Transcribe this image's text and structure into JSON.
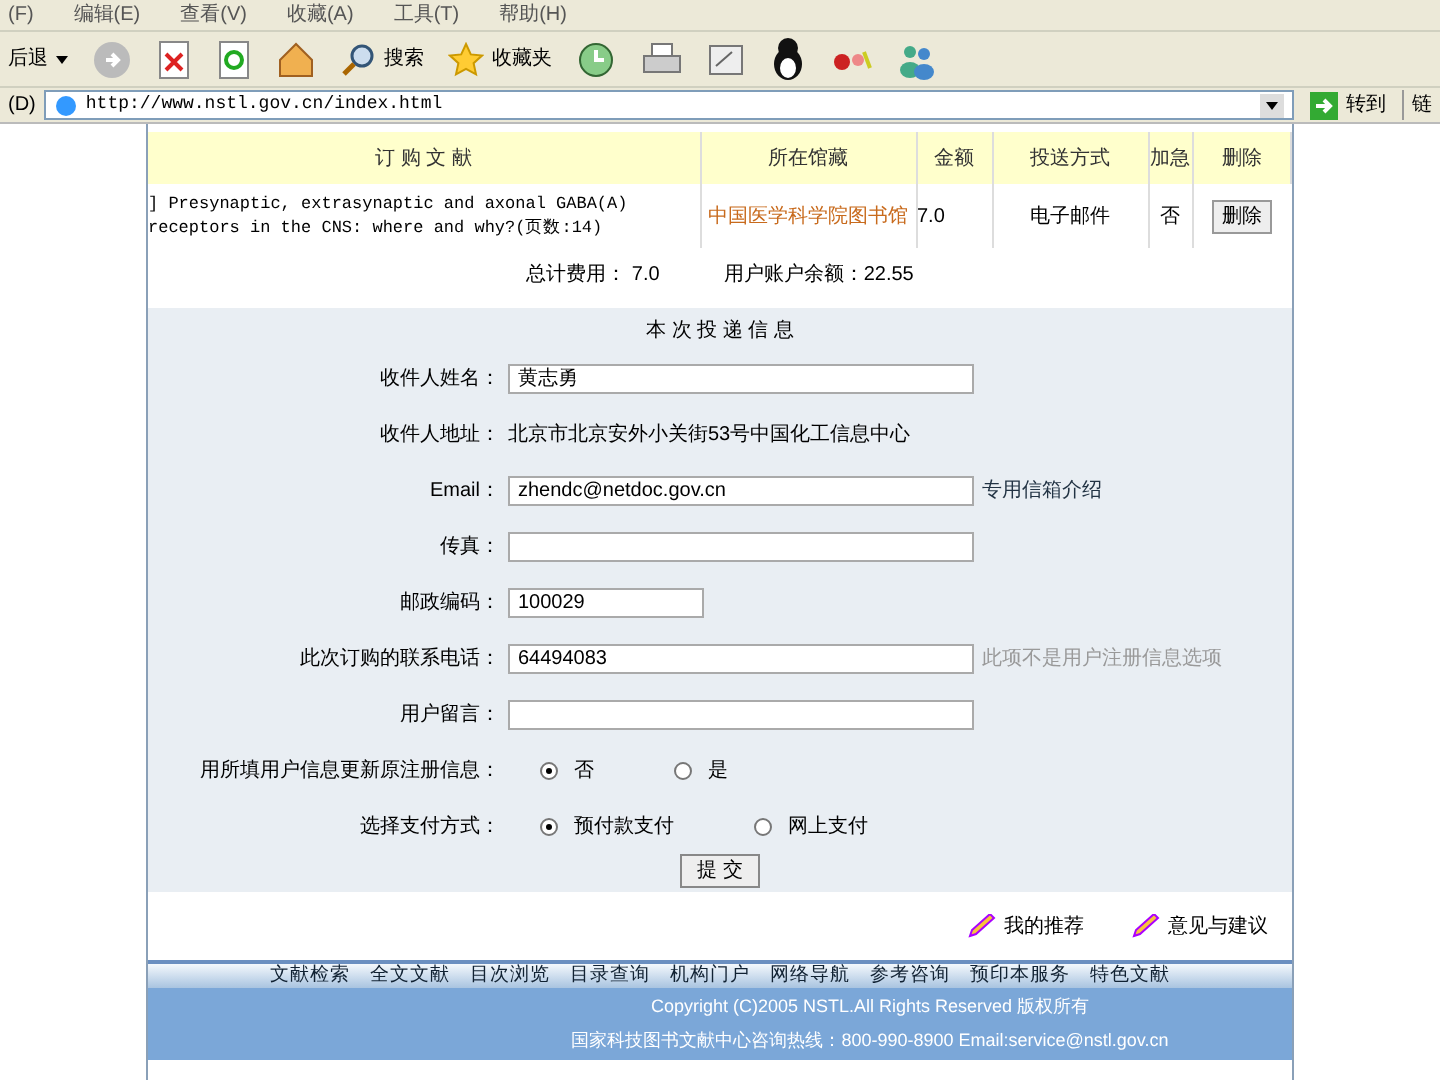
{
  "menu": [
    "(F)",
    "编辑(E)",
    "查看(V)",
    "收藏(A)",
    "工具(T)",
    "帮助(H)"
  ],
  "toolbar": {
    "back": "后退",
    "search": "搜索",
    "favorites": "收藏夹"
  },
  "address": {
    "label": "(D)",
    "url": "http://www.nstl.gov.cn/index.html",
    "go": "转到",
    "links": "链"
  },
  "order_table": {
    "columns": [
      "订 购 文 献",
      "所在馆藏",
      "金额",
      "投送方式",
      "加急",
      "删除"
    ],
    "rows": [
      {
        "title": "] Presynaptic, extrasynaptic and axonal GABA(A) receptors in the CNS: where and why?(页数:14)",
        "library": "中国医学科学院图书馆",
        "amount": "7.0",
        "delivery": "电子邮件",
        "urgent": "否",
        "action": "删除"
      }
    ]
  },
  "totals": {
    "cost": "总计费用： 7.0",
    "balance": "用户账户余额：22.55"
  },
  "delivery_form": {
    "title": "本 次 投 递 信 息",
    "rows": [
      {
        "kind": "input",
        "label": "收件人姓名：",
        "value": "黄志勇"
      },
      {
        "kind": "text",
        "label": "收件人地址：",
        "value": "北京市北京安外小关街53号中国化工信息中心"
      },
      {
        "kind": "input",
        "label": "Email：",
        "value": "zhendc@netdoc.gov.cn",
        "note": {
          "kind": "link",
          "text": "专用信箱介绍"
        }
      },
      {
        "kind": "input",
        "label": "传真：",
        "value": ""
      },
      {
        "kind": "short_input",
        "label": "邮政编码：",
        "value": "100029"
      },
      {
        "kind": "input",
        "label": "此次订购的联系电话：",
        "value": "64494083",
        "note": {
          "kind": "hint",
          "text": "此项不是用户注册信息选项"
        }
      },
      {
        "kind": "input",
        "label": "用户留言：",
        "value": ""
      },
      {
        "kind": "radio",
        "label": "用所填用户信息更新原注册信息：",
        "options": [
          {
            "label": "否",
            "selected": true
          },
          {
            "label": "是",
            "selected": false
          }
        ]
      },
      {
        "kind": "radio",
        "label": "选择支付方式：",
        "options": [
          {
            "label": "预付款支付",
            "selected": true
          },
          {
            "label": "网上支付",
            "selected": false
          }
        ]
      }
    ],
    "submit": "提 交"
  },
  "page_links": [
    "我的推荐",
    "意见与建议"
  ],
  "nav": [
    "文献检索",
    "全文文献",
    "目次浏览",
    "目录查询",
    "机构门户",
    "网络导航",
    "参考咨询",
    "预印本服务",
    "特色文献"
  ],
  "footer": [
    "Copyright (C)2005 NSTL.All Rights Reserved 版权所有",
    "国家科技图书文献中心咨询热线：800-990-8900 Email:service@nstl.gov.cn"
  ]
}
